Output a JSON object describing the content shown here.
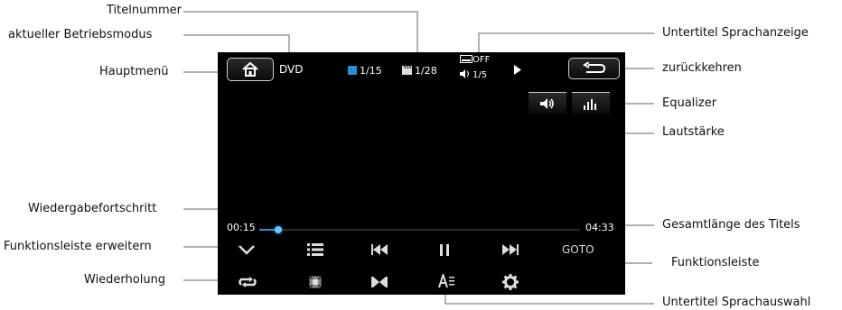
{
  "callouts": {
    "title_number": "Titelnummer",
    "current_mode": "aktueller Betriebsmodus",
    "main_menu": "Hauptmenü",
    "subtitle_language_display": "Untertitel Sprachanzeige",
    "go_back": "zurückkehren",
    "equalizer": "Equalizer",
    "volume": "Lautstärke",
    "playback_progress": "Wiedergabefortschritt",
    "total_length": "Gesamtlänge des Titels",
    "expand_function_bar": "Funktionsleiste erweitern",
    "function_bar": "Funktionsleiste",
    "repeat": "Wiederholung",
    "subtitle_language_select": "Untertitel Sprachauswahl"
  },
  "screen": {
    "mode": "DVD",
    "title_counter": "1/15",
    "chapter_counter": "1/28",
    "subtitle_state": "OFF",
    "audio_track": "1/5",
    "elapsed": "00:15",
    "total": "04:33",
    "goto_label": "GOTO",
    "progress_fraction": 0.06
  },
  "icons": {
    "home": "home-icon",
    "back": "back-arrow-icon",
    "volume": "speaker-icon",
    "equalizer": "equalizer-icon",
    "expand": "chevron-down-icon",
    "list": "list-icon",
    "previous": "skip-previous-icon",
    "pause": "pause-icon",
    "next": "skip-next-icon",
    "repeat": "repeat-icon",
    "zoom": "zoom-frame-icon",
    "split": "split-icon",
    "subtitle": "subtitle-select-icon",
    "settings": "gear-icon"
  },
  "colors": {
    "screen_bg": "#000000",
    "progress": "#2a8dd8",
    "leader_lines": "#999999"
  }
}
